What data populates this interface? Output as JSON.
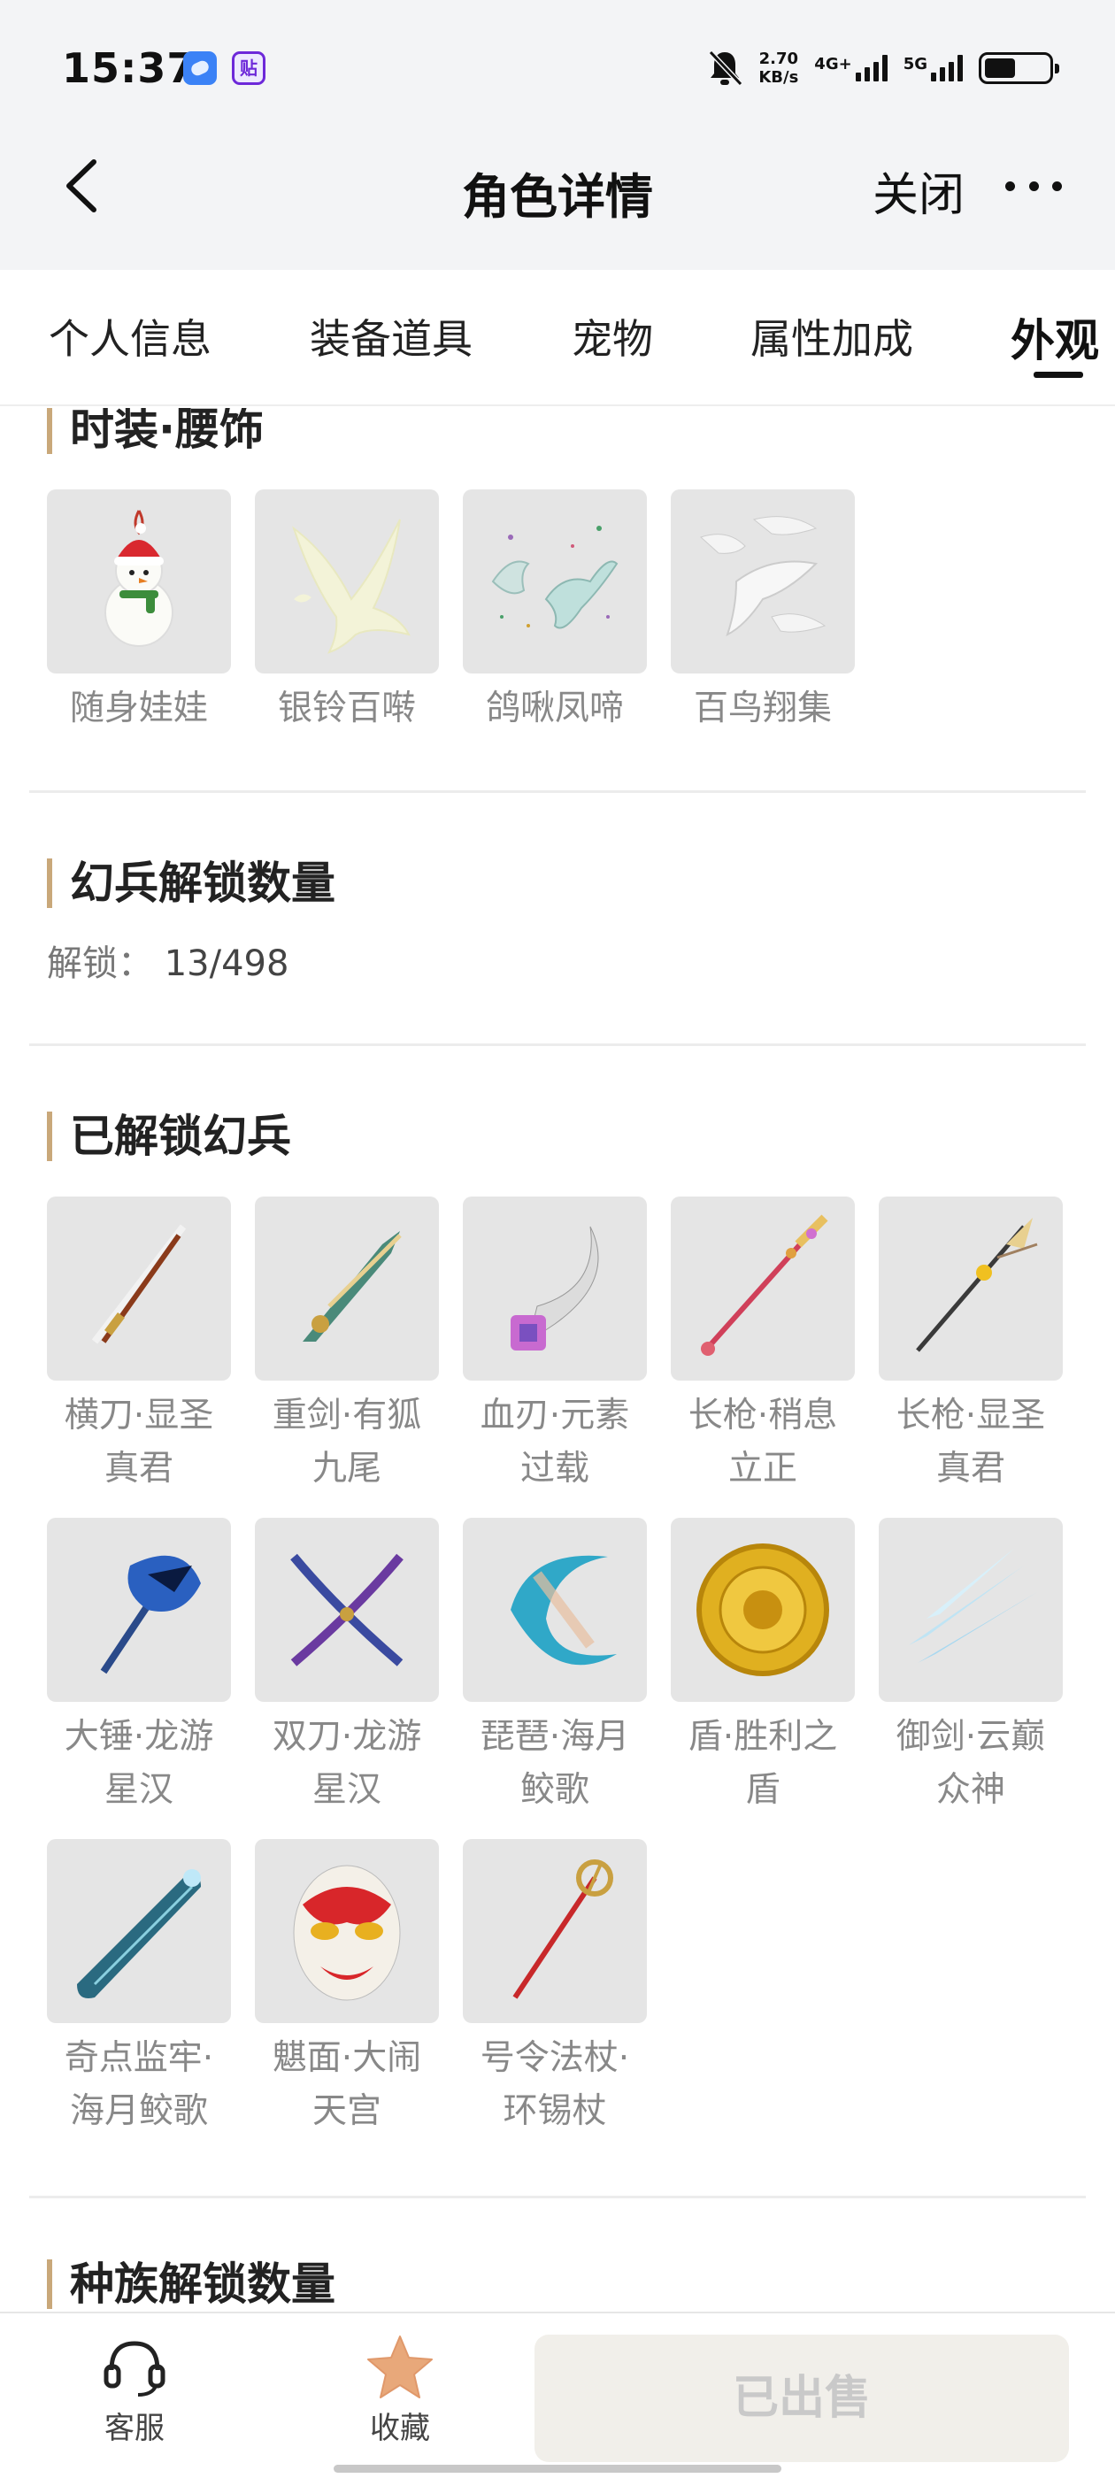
{
  "status_bar": {
    "time": "15:37",
    "net_speed_value": "2.70",
    "net_speed_unit": "KB/s",
    "net_type_1": "4G+",
    "net_type_2": "5G",
    "app_badge": "贴"
  },
  "header": {
    "title": "角色详情",
    "close_label": "关闭"
  },
  "tabs": [
    "个人信息",
    "装备道具",
    "宠物",
    "属性加成",
    "外观"
  ],
  "active_tab": "外观",
  "sections": {
    "waist": {
      "title": "时装·腰饰",
      "items": [
        "随身娃娃",
        "银铃百啭",
        "鸽啾凤啼",
        "百鸟翔集"
      ]
    },
    "weapon_count": {
      "title": "幻兵解锁数量",
      "label": "解锁：",
      "value": "13/498"
    },
    "unlocked_weapons": {
      "title": "已解锁幻兵",
      "items": [
        {
          "line1": "横刀·显圣",
          "line2": "真君"
        },
        {
          "line1": "重剑·有狐",
          "line2": "九尾"
        },
        {
          "line1": "血刃·元素",
          "line2": "过载"
        },
        {
          "line1": "长枪·稍息",
          "line2": "立正"
        },
        {
          "line1": "长枪·显圣",
          "line2": "真君"
        },
        {
          "line1": "大锤·龙游",
          "line2": "星汉"
        },
        {
          "line1": "双刀·龙游",
          "line2": "星汉"
        },
        {
          "line1": "琵琶·海月",
          "line2": "鲛歌"
        },
        {
          "line1": "盾·胜利之",
          "line2": "盾"
        },
        {
          "line1": "御剑·云巅",
          "line2": "众神"
        },
        {
          "line1": "奇点监牢·",
          "line2": "海月鲛歌"
        },
        {
          "line1": "魌面·大闹",
          "line2": "天宫"
        },
        {
          "line1": "号令法杖·",
          "line2": "环锡杖"
        }
      ]
    },
    "race_count": {
      "title": "种族解锁数量"
    }
  },
  "bottom_bar": {
    "service_label": "客服",
    "favorite_label": "收藏",
    "sold_label": "已出售"
  },
  "icons": {
    "back": "chevron-left-icon",
    "more": "more-dots-icon",
    "service": "headset-icon",
    "favorite": "star-icon"
  },
  "colors": {
    "section_accent": "#c9a87a",
    "favorite_star": "#e8a87a",
    "sold_button_bg": "#f1efea"
  }
}
